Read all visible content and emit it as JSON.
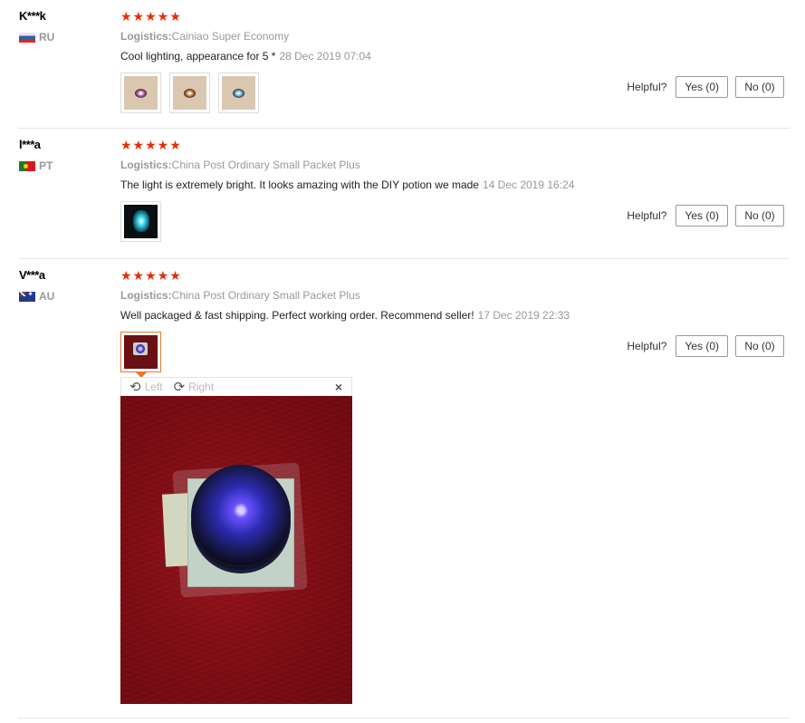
{
  "reviews": [
    {
      "user": "K***k",
      "country": "RU",
      "stars": "★★★★★",
      "logistics_label": "Logistics:",
      "logistics_value": "Cainiao Super Economy",
      "text": "Cool lighting, appearance for 5 *",
      "date": "28 Dec 2019 07:04",
      "helpful_label": "Helpful?",
      "yes_label": "Yes (0)",
      "no_label": "No (0)"
    },
    {
      "user": "l***a",
      "country": "PT",
      "stars": "★★★★★",
      "logistics_label": "Logistics:",
      "logistics_value": "China Post Ordinary Small Packet Plus",
      "text": "The light is extremely bright. It looks amazing with the DIY potion we made",
      "date": "14 Dec 2019 16:24",
      "helpful_label": "Helpful?",
      "yes_label": "Yes (0)",
      "no_label": "No (0)"
    },
    {
      "user": "V***a",
      "country": "AU",
      "stars": "★★★★★",
      "logistics_label": "Logistics:",
      "logistics_value": "China Post Ordinary Small Packet Plus",
      "text": "Well packaged & fast shipping. Perfect working order. Recommend seller!",
      "date": "17 Dec 2019 22:33",
      "helpful_label": "Helpful?",
      "yes_label": "Yes (0)",
      "no_label": "No (0)"
    }
  ],
  "viewer": {
    "rotate_left_label": "Left",
    "rotate_right_label": "Right",
    "close_glyph": "×"
  },
  "colors": {
    "star": "#e62e04",
    "active_thumb_border": "#e57b2c",
    "muted_text": "#999999"
  }
}
